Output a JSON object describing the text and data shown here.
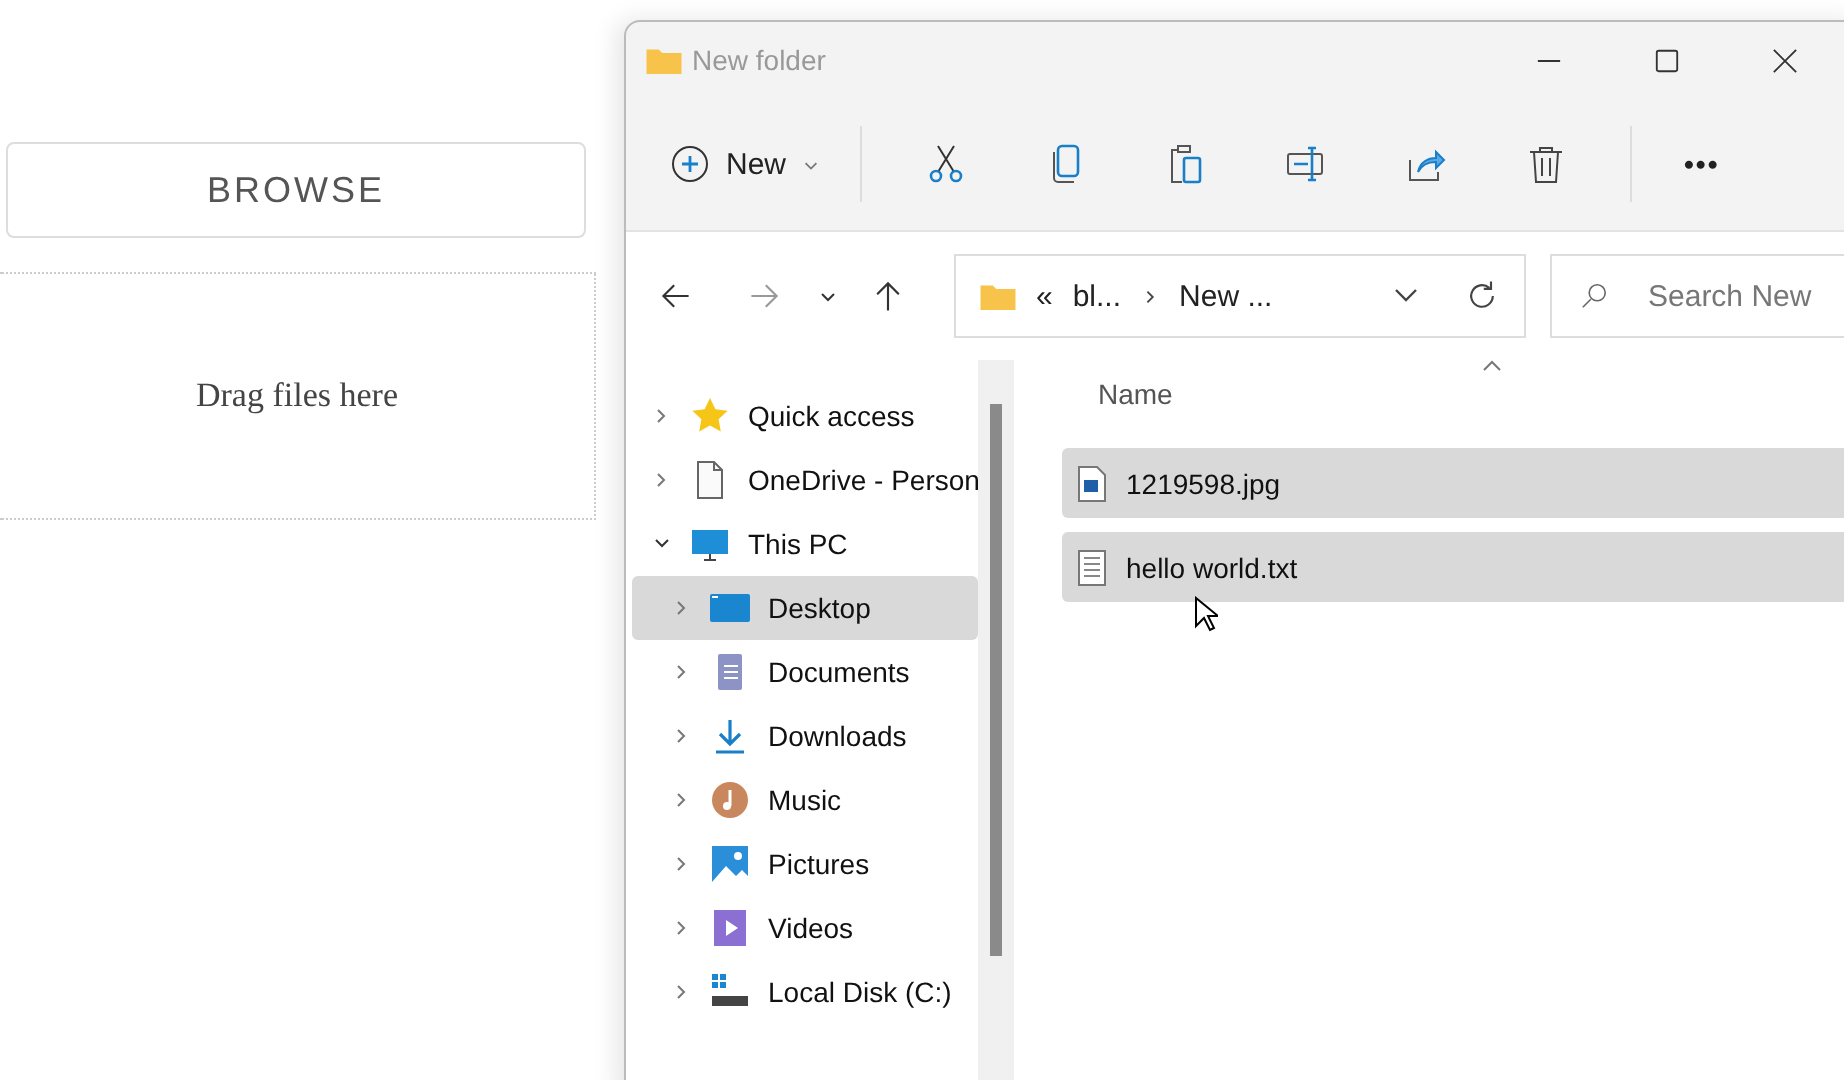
{
  "page": {
    "browse_button": "BROWSE",
    "drop_zone": "Drag files here"
  },
  "window": {
    "title": "New folder",
    "toolbar": {
      "new_button": "New",
      "more_button": "•••"
    },
    "address": {
      "overflow": "«",
      "segments": [
        "bl...",
        "New ..."
      ]
    },
    "search": {
      "placeholder": "Search New"
    },
    "navigation": [
      {
        "label": "Quick access",
        "kind": "star",
        "expanded": false,
        "selected": false
      },
      {
        "label": "OneDrive - Person",
        "kind": "page",
        "expanded": false,
        "selected": false
      },
      {
        "label": "This PC",
        "kind": "monitor",
        "expanded": true,
        "selected": false,
        "children": [
          {
            "label": "Desktop",
            "kind": "desktop",
            "expanded": false,
            "selected": true
          },
          {
            "label": "Documents",
            "kind": "documents",
            "expanded": false,
            "selected": false
          },
          {
            "label": "Downloads",
            "kind": "download",
            "expanded": false,
            "selected": false
          },
          {
            "label": "Music",
            "kind": "music",
            "expanded": false,
            "selected": false
          },
          {
            "label": "Pictures",
            "kind": "pictures",
            "expanded": false,
            "selected": false
          },
          {
            "label": "Videos",
            "kind": "videos",
            "expanded": false,
            "selected": false
          },
          {
            "label": "Local Disk (C:)",
            "kind": "disk",
            "expanded": false,
            "selected": false
          }
        ]
      }
    ],
    "columns": [
      "Name"
    ],
    "files": [
      {
        "name": "1219598.jpg",
        "kind": "image",
        "selected": true
      },
      {
        "name": "hello world.txt",
        "kind": "text",
        "selected": true
      }
    ]
  }
}
